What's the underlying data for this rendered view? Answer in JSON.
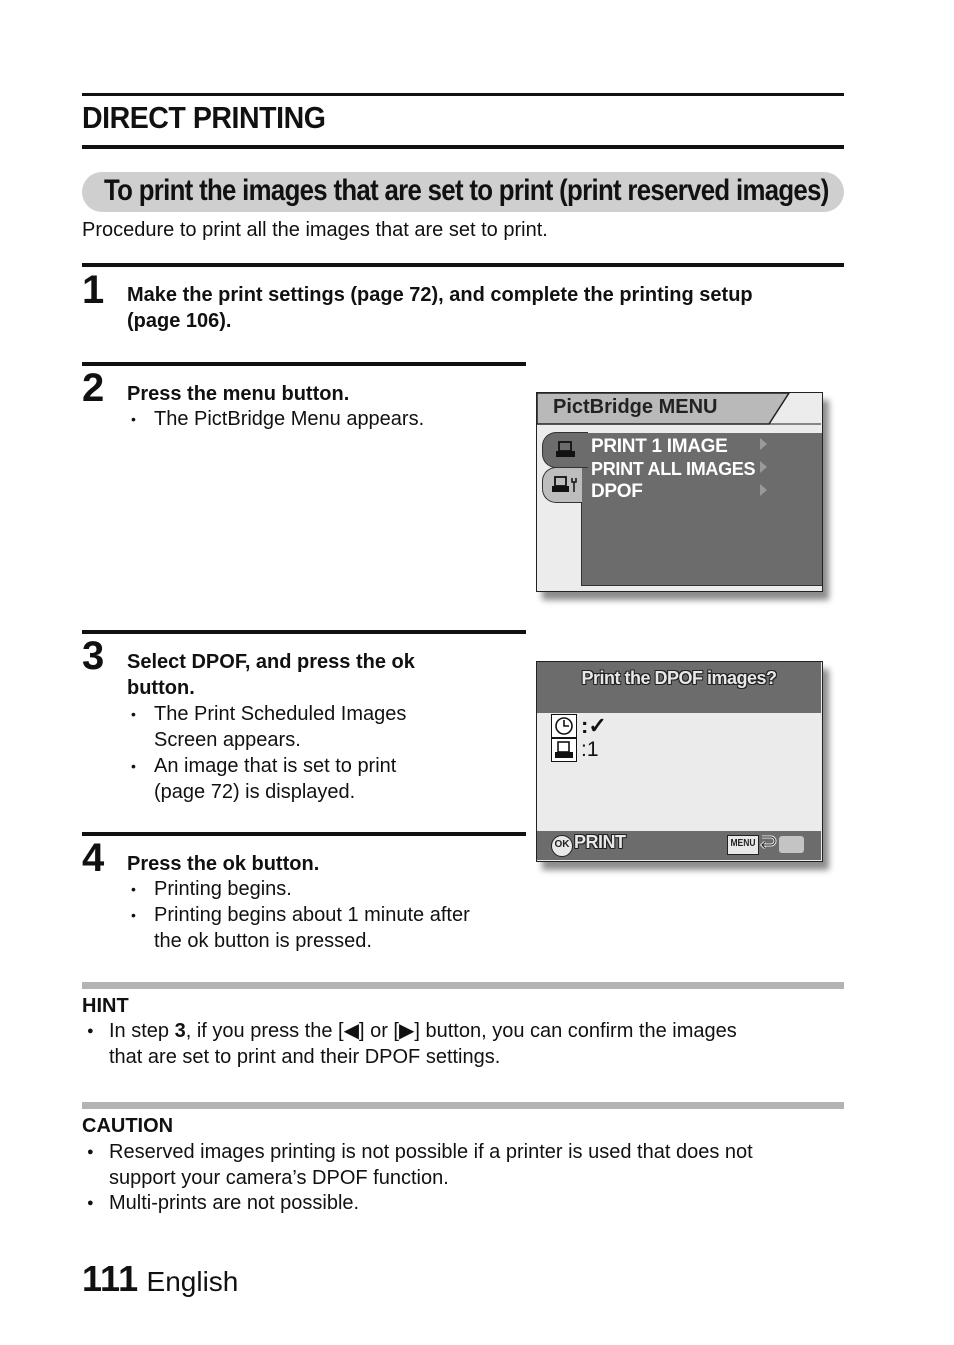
{
  "section": {
    "title": "DIRECT PRINTING"
  },
  "subsection": {
    "title": "To print the images that are set to print (print reserved images)",
    "intro": "Procedure to print all the images that are set to print."
  },
  "steps": [
    {
      "number": "1",
      "title_line1": "Make the print settings (page 72), and complete the printing setup",
      "title_line2": "(page 106).",
      "bullets": []
    },
    {
      "number": "2",
      "title_line1": "Press the menu button.",
      "bullets": [
        "The PictBridge Menu appears."
      ]
    },
    {
      "number": "3",
      "title_line1": "Select DPOF, and press the ok",
      "title_line2": "button.",
      "bullets": [
        "The Print Scheduled Images",
        "Screen appears.",
        "An image that is set to print",
        "(page 72) is displayed."
      ]
    },
    {
      "number": "4",
      "title_line1": "Press the ok button.",
      "bullets": [
        "Printing begins.",
        "Printing begins about 1 minute after",
        "the ok button is pressed."
      ]
    }
  ],
  "pictbridge_menu": {
    "title": "PictBridge MENU",
    "tabs": [
      {
        "icon": "printer-icon",
        "active": true
      },
      {
        "icon": "printer-settings-icon",
        "active": false
      }
    ],
    "items": [
      "PRINT 1 IMAGE",
      "PRINT ALL IMAGES",
      "DPOF"
    ]
  },
  "dpof_screen": {
    "title": "Print the DPOF images?",
    "rows": [
      {
        "icon": "clock-icon",
        "value": ":✓"
      },
      {
        "icon": "printer-icon",
        "value": ":1"
      }
    ],
    "footer": {
      "ok_label": "OK",
      "print_label": "PRINT",
      "menu_label": "MENU"
    }
  },
  "hint": {
    "title": "HINT",
    "line1_pre": "In step ",
    "line1_bold": "3",
    "line1_post": ", if you press the [◀] or [▶] button, you can confirm the images",
    "line2": "that are set to print and their DPOF settings."
  },
  "caution": {
    "title": "CAUTION",
    "items": [
      {
        "line1": "Reserved images printing is not possible if a printer is used that does not",
        "line2": "support your camera’s DPOF function."
      },
      {
        "line1": "Multi-prints are not possible."
      }
    ]
  },
  "footer": {
    "page_number": "111",
    "language": "English"
  }
}
